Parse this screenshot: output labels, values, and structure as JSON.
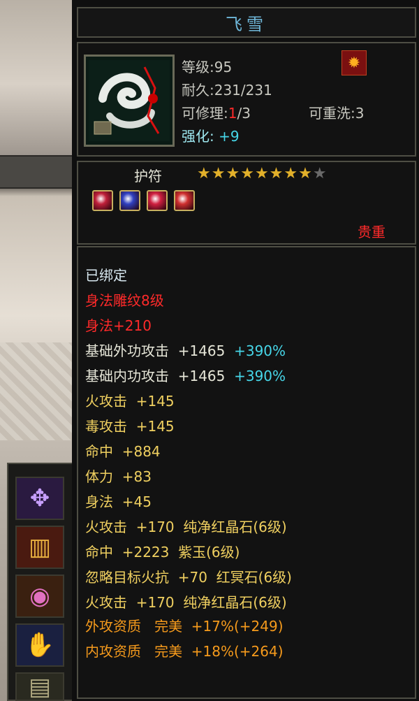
{
  "item": {
    "name": "飞雪",
    "level": "等级:95",
    "durability": "耐久:231/231",
    "repair_label": "可修理:",
    "repair_used": "1",
    "repair_total": "/3",
    "rewash": "可重洗:3",
    "enhance_label": "强化:",
    "enhance_value": "+9",
    "type": "护符",
    "stars_filled": 8,
    "stars_total": 9,
    "star_glyph": "★",
    "gem_colors": [
      "#c0203a",
      "#3040c0",
      "#d02040",
      "#d03030"
    ],
    "rarity": "贵重",
    "bound": "已绑定",
    "engrave": "身法雕纹8级",
    "engrave_bonus": "身法+210",
    "base_outer": {
      "label": "基础外功攻击  +1465",
      "pct": "+390%"
    },
    "base_inner": {
      "label": "基础内功攻击  +1465",
      "pct": "+390%"
    },
    "attrs": [
      "火攻击  +145",
      "毒攻击  +145",
      "命中  +884",
      "体力  +83",
      "身法  +45"
    ],
    "gems": [
      "火攻击  +170  纯净红晶石(6级)",
      "命中  +2223  紫玉(6级)",
      "忽略目标火抗  +70  红冥石(6级)",
      "火攻击  +170  纯净红晶石(6级)"
    ],
    "qualities": [
      "外攻资质   完美  +17%(+249)",
      "内攻资质   完美  +18%(+264)"
    ]
  },
  "colors": {
    "title": "#6fb7d9",
    "enhance": "#46d6e8",
    "red": "#ff2a2a",
    "yellow": "#f0d060",
    "orange": "#f59a1c",
    "star": "#e2b02a"
  },
  "side_slots": [
    "scorpion-ornament-icon",
    "scroll-icon",
    "bracer-icon",
    "gauntlet-icon",
    "armor-icon"
  ]
}
